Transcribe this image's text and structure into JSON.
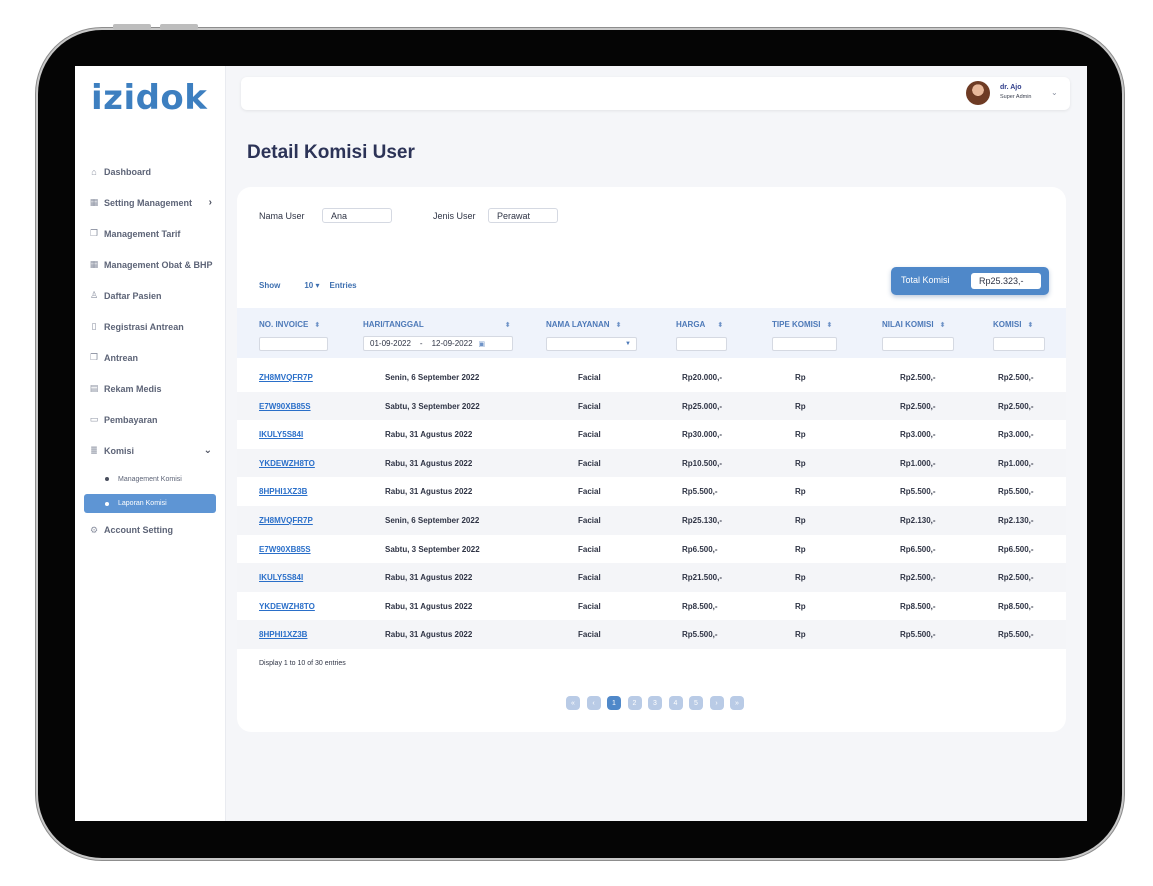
{
  "app": {
    "logo": "izidok"
  },
  "sidebar": {
    "items": [
      {
        "label": "Dashboard",
        "icon": "home-icon"
      },
      {
        "label": "Setting Management",
        "icon": "grid-icon"
      },
      {
        "label": "Management Tarif",
        "icon": "copy-icon"
      },
      {
        "label": "Management Obat & BHP",
        "icon": "grid-icon"
      },
      {
        "label": "Daftar Pasien",
        "icon": "user-icon"
      },
      {
        "label": "Registrasi Antrean",
        "icon": "file-add-icon"
      },
      {
        "label": "Antrean",
        "icon": "copy-icon"
      },
      {
        "label": "Rekam Medis",
        "icon": "document-icon"
      },
      {
        "label": "Pembayaran",
        "icon": "payment-icon"
      },
      {
        "label": "Komisi",
        "icon": "money-icon"
      },
      {
        "label": "Management Komisi"
      },
      {
        "label": "Laporan Komisi"
      },
      {
        "label": "Account Setting",
        "icon": "gear-icon"
      }
    ]
  },
  "header": {
    "user_name": "dr. Ajo",
    "user_role": "Super Admin"
  },
  "page": {
    "title": "Detail Komisi User"
  },
  "filters": {
    "nama_user_label": "Nama User",
    "nama_user_value": "Ana",
    "jenis_user_label": "Jenis User",
    "jenis_user_value": "Perawat"
  },
  "show": {
    "label": "Show",
    "value": "10",
    "suffix": "Entries"
  },
  "total": {
    "label": "Total Komisi",
    "value": "Rp25.323,-"
  },
  "table": {
    "columns": [
      "NO. INVOICE",
      "HARI/TANGGAL",
      "NAMA LAYANAN",
      "HARGA",
      "TIPE KOMISI",
      "NILAI KOMISI",
      "KOMISI"
    ],
    "date_from": "01-09-2022",
    "date_sep": "-",
    "date_to": "12-09-2022",
    "rows": [
      [
        "ZH8MVQFR7P",
        "Senin, 6 September 2022",
        "Facial",
        "Rp20.000,-",
        "Rp",
        "Rp2.500,-",
        "Rp2.500,-"
      ],
      [
        "E7W90XB85S",
        "Sabtu, 3 September 2022",
        "Facial",
        "Rp25.000,-",
        "Rp",
        "Rp2.500,-",
        "Rp2.500,-"
      ],
      [
        "IKULY5S84I",
        "Rabu, 31 Agustus 2022",
        "Facial",
        "Rp30.000,-",
        "Rp",
        "Rp3.000,-",
        "Rp3.000,-"
      ],
      [
        "YKDEWZH8TO",
        "Rabu, 31 Agustus 2022",
        "Facial",
        "Rp10.500,-",
        "Rp",
        "Rp1.000,-",
        "Rp1.000,-"
      ],
      [
        "8HPHI1XZ3B",
        "Rabu, 31 Agustus 2022",
        "Facial",
        "Rp5.500,-",
        "Rp",
        "Rp5.500,-",
        "Rp5.500,-"
      ],
      [
        "ZH8MVQFR7P",
        "Senin, 6 September 2022",
        "Facial",
        "Rp25.130,-",
        "Rp",
        "Rp2.130,-",
        "Rp2.130,-"
      ],
      [
        "E7W90XB85S",
        "Sabtu, 3 September 2022",
        "Facial",
        "Rp6.500,-",
        "Rp",
        "Rp6.500,-",
        "Rp6.500,-"
      ],
      [
        "IKULY5S84I",
        "Rabu, 31 Agustus 2022",
        "Facial",
        "Rp21.500,-",
        "Rp",
        "Rp2.500,-",
        "Rp2.500,-"
      ],
      [
        "YKDEWZH8TO",
        "Rabu, 31 Agustus 2022",
        "Facial",
        "Rp8.500,-",
        "Rp",
        "Rp8.500,-",
        "Rp8.500,-"
      ],
      [
        "8HPHI1XZ3B",
        "Rabu, 31 Agustus 2022",
        "Facial",
        "Rp5.500,-",
        "Rp",
        "Rp5.500,-",
        "Rp5.500,-"
      ]
    ]
  },
  "footer": {
    "entries_text": "Display 1 to 10 of 30 entries"
  },
  "pagination": {
    "first": "«",
    "prev": "‹",
    "pages": [
      "1",
      "2",
      "3",
      "4",
      "5"
    ],
    "next": "›",
    "last": "»",
    "current": "1"
  },
  "colors": {
    "brand": "#3d7fc0",
    "accent": "#4f88c9",
    "title": "#2c3357"
  }
}
